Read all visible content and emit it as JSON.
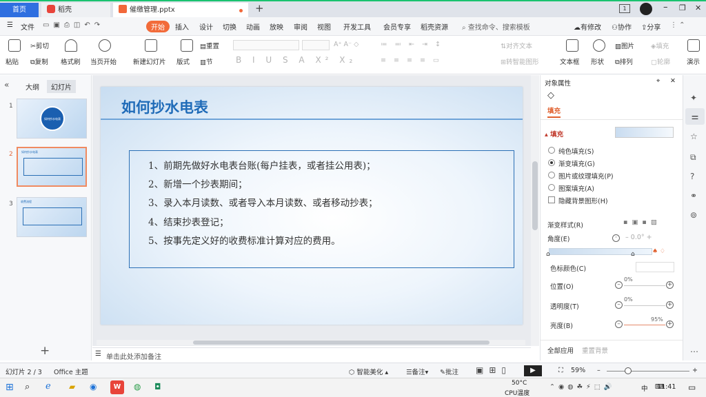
{
  "tabs": {
    "home": "首页",
    "daoke": "稻壳",
    "doc": "催缴管理.pptx",
    "new": "+"
  },
  "window": {
    "badge": "1",
    "min": "–",
    "restore": "❐",
    "close": "✕"
  },
  "menu": {
    "file": "文件",
    "items": [
      "开始",
      "插入",
      "设计",
      "切换",
      "动画",
      "放映",
      "审阅",
      "视图",
      "开发工具",
      "会员专享",
      "稻壳资源"
    ],
    "search": "查找命令、搜索模板",
    "pending": "有修改",
    "collab": "协作",
    "share": "分享"
  },
  "ribbon": {
    "paste": "粘贴",
    "cut": "剪切",
    "copy": "复制",
    "format": "格式刷",
    "play": "当页开始",
    "new_slide": "新建幻灯片",
    "layout": "版式",
    "section": "节",
    "reset": "重置",
    "text_dir": "对齐文本",
    "textbox": "文本框",
    "shape": "形状",
    "picture": "图片",
    "arrange": "排列",
    "fill": "填充",
    "outline": "轮廓",
    "convert": "转智能图形",
    "more": "演示"
  },
  "left": {
    "tab_outline": "大纲",
    "tab_slides": "幻灯片",
    "nums": [
      "1",
      "2",
      "3"
    ],
    "thumb1": "如何抄水电表",
    "thumb2": "如何抄水电表",
    "thumb3": "收费流程"
  },
  "slide": {
    "title": "如何抄水电表",
    "items": [
      "1、前期先做好水电表台账(每户挂表，或者挂公用表)；",
      "2、新增一个抄表期间；",
      "3、录入本月读数、或者导入本月读数、或者移动抄表；",
      "4、结束抄表登记；",
      "5、按事先定义好的收费标准计算对应的费用。"
    ]
  },
  "notes": {
    "placeholder": "单击此处添加备注"
  },
  "panel": {
    "title": "对象属性",
    "tab": "填充",
    "section": "填充",
    "options": [
      "纯色填充(S)",
      "渐变填充(G)",
      "图片或纹理填充(P)",
      "图案填充(A)"
    ],
    "hide_bg": "隐藏背景图形(H)",
    "grad_style": "渐变样式(R)",
    "angle": "角度(E)",
    "angle_val": "0.0°",
    "stop_color": "色标颜色(C)",
    "position": "位置(O)",
    "position_val": "0%",
    "transparency": "透明度(T)",
    "transparency_val": "0%",
    "brightness": "亮度(B)",
    "brightness_val": "95%",
    "apply_all": "全部应用",
    "reset_bg": "重置背景"
  },
  "status": {
    "slide": "幻灯片 2 / 3",
    "theme": "Office 主题",
    "beautify": "智能美化",
    "notes": "备注",
    "comment": "批注",
    "zoom": "59%"
  },
  "taskbar": {
    "temp": "50°C",
    "cpu": "CPU温度",
    "ime": "中",
    "time": "11:41"
  }
}
